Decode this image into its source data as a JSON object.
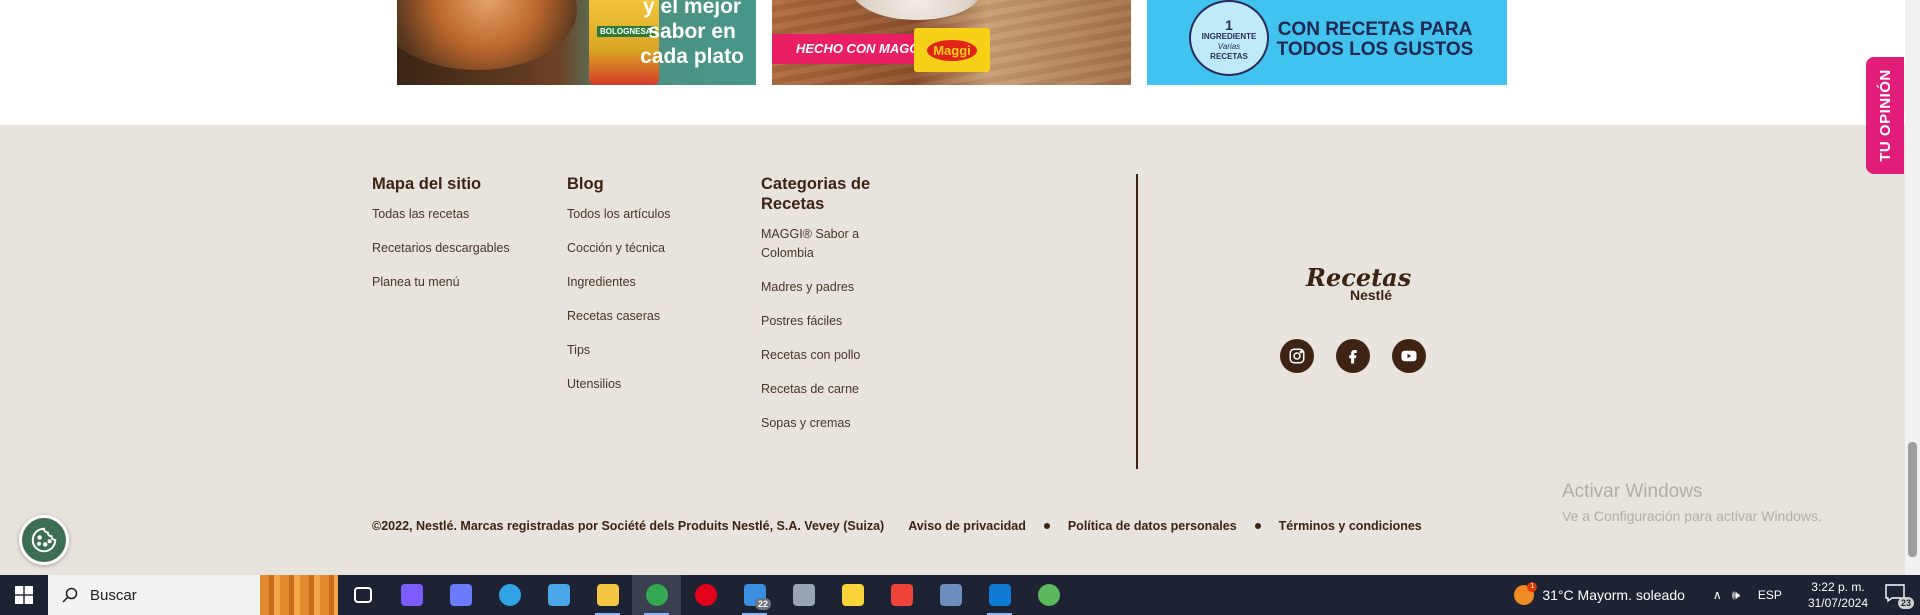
{
  "banners": {
    "banner_1": {
      "text_lines": [
        "y el mejor",
        "sabor en",
        "cada plato"
      ],
      "pack_label": "BOLOGNESA"
    },
    "banner_2": {
      "label": "HECHO CON MAGGI®",
      "logo": "Maggi"
    },
    "banner_3": {
      "badge_lines": [
        "1",
        "INGREDIENTE",
        "Varias",
        "RECETAS"
      ],
      "text_lines": [
        "CON RECETAS PARA",
        "TODOS LOS GUSTOS"
      ]
    }
  },
  "footer": {
    "site_map": {
      "heading": "Mapa del sitio",
      "links": [
        "Todas las recetas",
        "Recetarios descargables",
        "Planea tu menú"
      ]
    },
    "blog": {
      "heading": "Blog",
      "links": [
        "Todos los artículos",
        "Cocción y técnica",
        "Ingredientes",
        "Recetas caseras",
        "Tips",
        "Utensilios"
      ]
    },
    "categories": {
      "heading": "Categorias de Recetas",
      "links": [
        "MAGGI® Sabor a Colombia",
        "Madres y padres",
        "Postres fáciles",
        "Recetas con pollo",
        "Recetas de carne",
        "Sopas y cremas"
      ]
    },
    "brand": {
      "script": "Recetas",
      "name": "Nestlé"
    },
    "social_icons": [
      "instagram-icon",
      "facebook-icon",
      "youtube-icon"
    ],
    "copyright": "©2022, Nestlé. Marcas registradas por Société dels Produits Nestlé, S.A. Vevey (Suiza)",
    "legal_links": [
      "Aviso de privacidad",
      "Política de datos personales",
      "Términos y condiciones"
    ]
  },
  "feedback_tab": "TU OPINIÓN",
  "windows_watermark": {
    "title": "Activar Windows",
    "subtitle": "Ve a Configuración para activar Windows."
  },
  "taskbar": {
    "search_placeholder": "Buscar",
    "apps": [
      {
        "icon": "task-view-icon",
        "color": "#ffffff"
      },
      {
        "icon": "copilot-icon",
        "color": "#7c5cff"
      },
      {
        "icon": "bing-icon",
        "color": "#6a7bff"
      },
      {
        "icon": "edge-icon",
        "color": "#2fa3e6"
      },
      {
        "icon": "store-icon",
        "color": "#4aa8e8"
      },
      {
        "icon": "file-explorer-icon",
        "color": "#f4c542"
      },
      {
        "icon": "chrome-icon",
        "color": "#34a853"
      },
      {
        "icon": "opera-icon",
        "color": "#e3001b"
      },
      {
        "icon": "mail-icon",
        "color": "#3b8fe0",
        "badge": "22"
      },
      {
        "icon": "photos-icon",
        "color": "#9aa5b1"
      },
      {
        "icon": "sticky-notes-icon",
        "color": "#f8d33a"
      },
      {
        "icon": "anydesk-icon",
        "color": "#ef443b"
      },
      {
        "icon": "network-app-icon",
        "color": "#6c8ebf"
      },
      {
        "icon": "vscode-icon",
        "color": "#0e7ad1"
      },
      {
        "icon": "utorrent-icon",
        "color": "#5cb85c"
      }
    ],
    "weather": "31°C  Mayorm. soleado",
    "weather_badge": "1",
    "language": "ESP",
    "time": "3:22 p. m.",
    "date": "31/07/2024",
    "notifications": "23"
  },
  "colors": {
    "footer_bg": "#e9e3dd",
    "brand_brown": "#3d2314",
    "feedback_pink": "#e21c79",
    "taskbar_bg": "#1d2333"
  }
}
